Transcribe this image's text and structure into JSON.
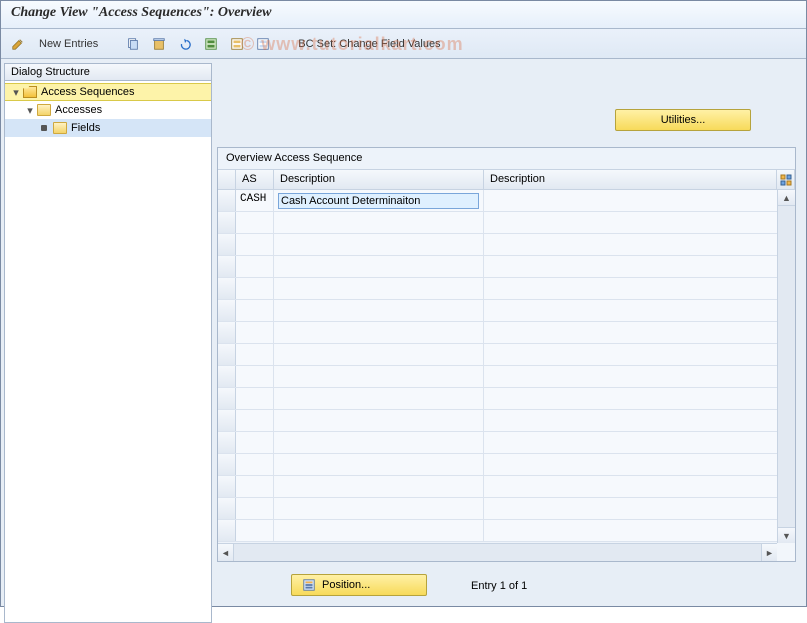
{
  "title": "Change View \"Access Sequences\": Overview",
  "toolbar": {
    "new_entries": "New Entries",
    "bc_set": "BC Set: Change Field Values"
  },
  "dialog_structure": {
    "header": "Dialog Structure",
    "nodes": {
      "root": {
        "label": "Access Sequences"
      },
      "accesses": {
        "label": "Accesses"
      },
      "fields": {
        "label": "Fields"
      }
    }
  },
  "utilities_button": "Utilities...",
  "grid": {
    "title": "Overview Access Sequence",
    "columns": {
      "c1": "AS",
      "c2": "Description",
      "c3": "Description"
    },
    "rows": [
      {
        "as": "CASH",
        "desc": "Cash Account Determinaiton",
        "desc2": ""
      }
    ],
    "empty_row_count": 15
  },
  "position_button": "Position...",
  "entry_label": "Entry 1 of 1",
  "watermark": "© www.tutorialkart.com"
}
